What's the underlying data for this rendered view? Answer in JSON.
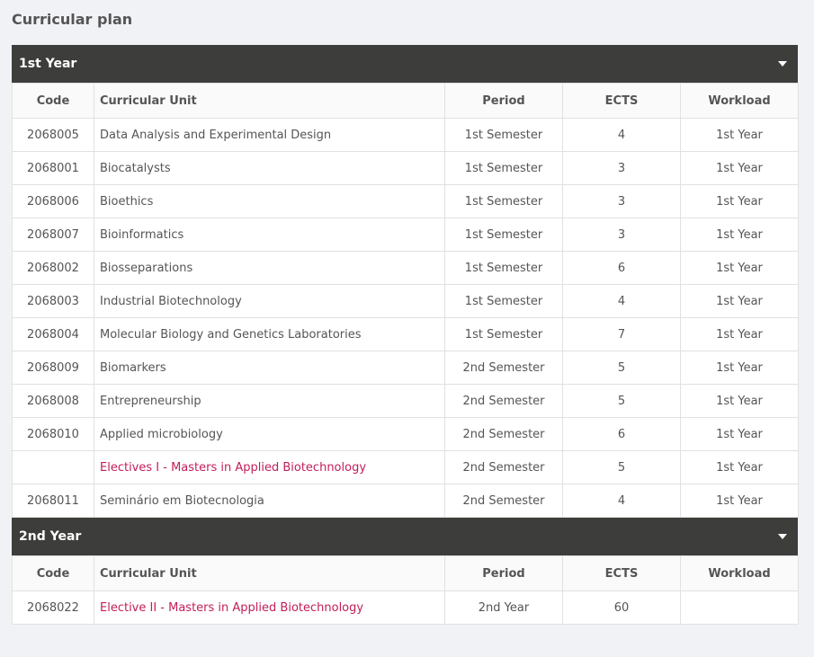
{
  "page": {
    "title": "Curricular plan"
  },
  "columns": {
    "code": "Code",
    "unit": "Curricular Unit",
    "period": "Period",
    "ects": "ECTS",
    "workload": "Workload"
  },
  "accent_color": "#c21d5a",
  "header_color": "#3d3d3b",
  "years": [
    {
      "label": "1st Year",
      "rows": [
        {
          "code": "2068005",
          "unit": "Data Analysis and Experimental Design",
          "period": "1st Semester",
          "ects": "4",
          "workload": "1st Year",
          "link": false
        },
        {
          "code": "2068001",
          "unit": "Biocatalysts",
          "period": "1st Semester",
          "ects": "3",
          "workload": "1st Year",
          "link": false
        },
        {
          "code": "2068006",
          "unit": "Bioethics",
          "period": "1st Semester",
          "ects": "3",
          "workload": "1st Year",
          "link": false
        },
        {
          "code": "2068007",
          "unit": "Bioinformatics",
          "period": "1st Semester",
          "ects": "3",
          "workload": "1st Year",
          "link": false
        },
        {
          "code": "2068002",
          "unit": "Biosseparations",
          "period": "1st Semester",
          "ects": "6",
          "workload": "1st Year",
          "link": false
        },
        {
          "code": "2068003",
          "unit": "Industrial Biotechnology",
          "period": "1st Semester",
          "ects": "4",
          "workload": "1st Year",
          "link": false
        },
        {
          "code": "2068004",
          "unit": "Molecular Biology and Genetics Laboratories",
          "period": "1st Semester",
          "ects": "7",
          "workload": "1st Year",
          "link": false
        },
        {
          "code": "2068009",
          "unit": "Biomarkers",
          "period": "2nd Semester",
          "ects": "5",
          "workload": "1st Year",
          "link": false
        },
        {
          "code": "2068008",
          "unit": "Entrepreneurship",
          "period": "2nd Semester",
          "ects": "5",
          "workload": "1st Year",
          "link": false
        },
        {
          "code": "2068010",
          "unit": "Applied microbiology",
          "period": "2nd Semester",
          "ects": "6",
          "workload": "1st Year",
          "link": false
        },
        {
          "code": "",
          "unit": "Electives I - Masters in Applied Biotechnology",
          "period": "2nd Semester",
          "ects": "5",
          "workload": "1st Year",
          "link": true
        },
        {
          "code": "2068011",
          "unit": "Seminário em Biotecnologia",
          "period": "2nd Semester",
          "ects": "4",
          "workload": "1st Year",
          "link": false
        }
      ]
    },
    {
      "label": "2nd Year",
      "rows": [
        {
          "code": "2068022",
          "unit": "Elective II - Masters in Applied Biotechnology",
          "period": "2nd Year",
          "ects": "60",
          "workload": "",
          "link": true
        }
      ]
    }
  ]
}
